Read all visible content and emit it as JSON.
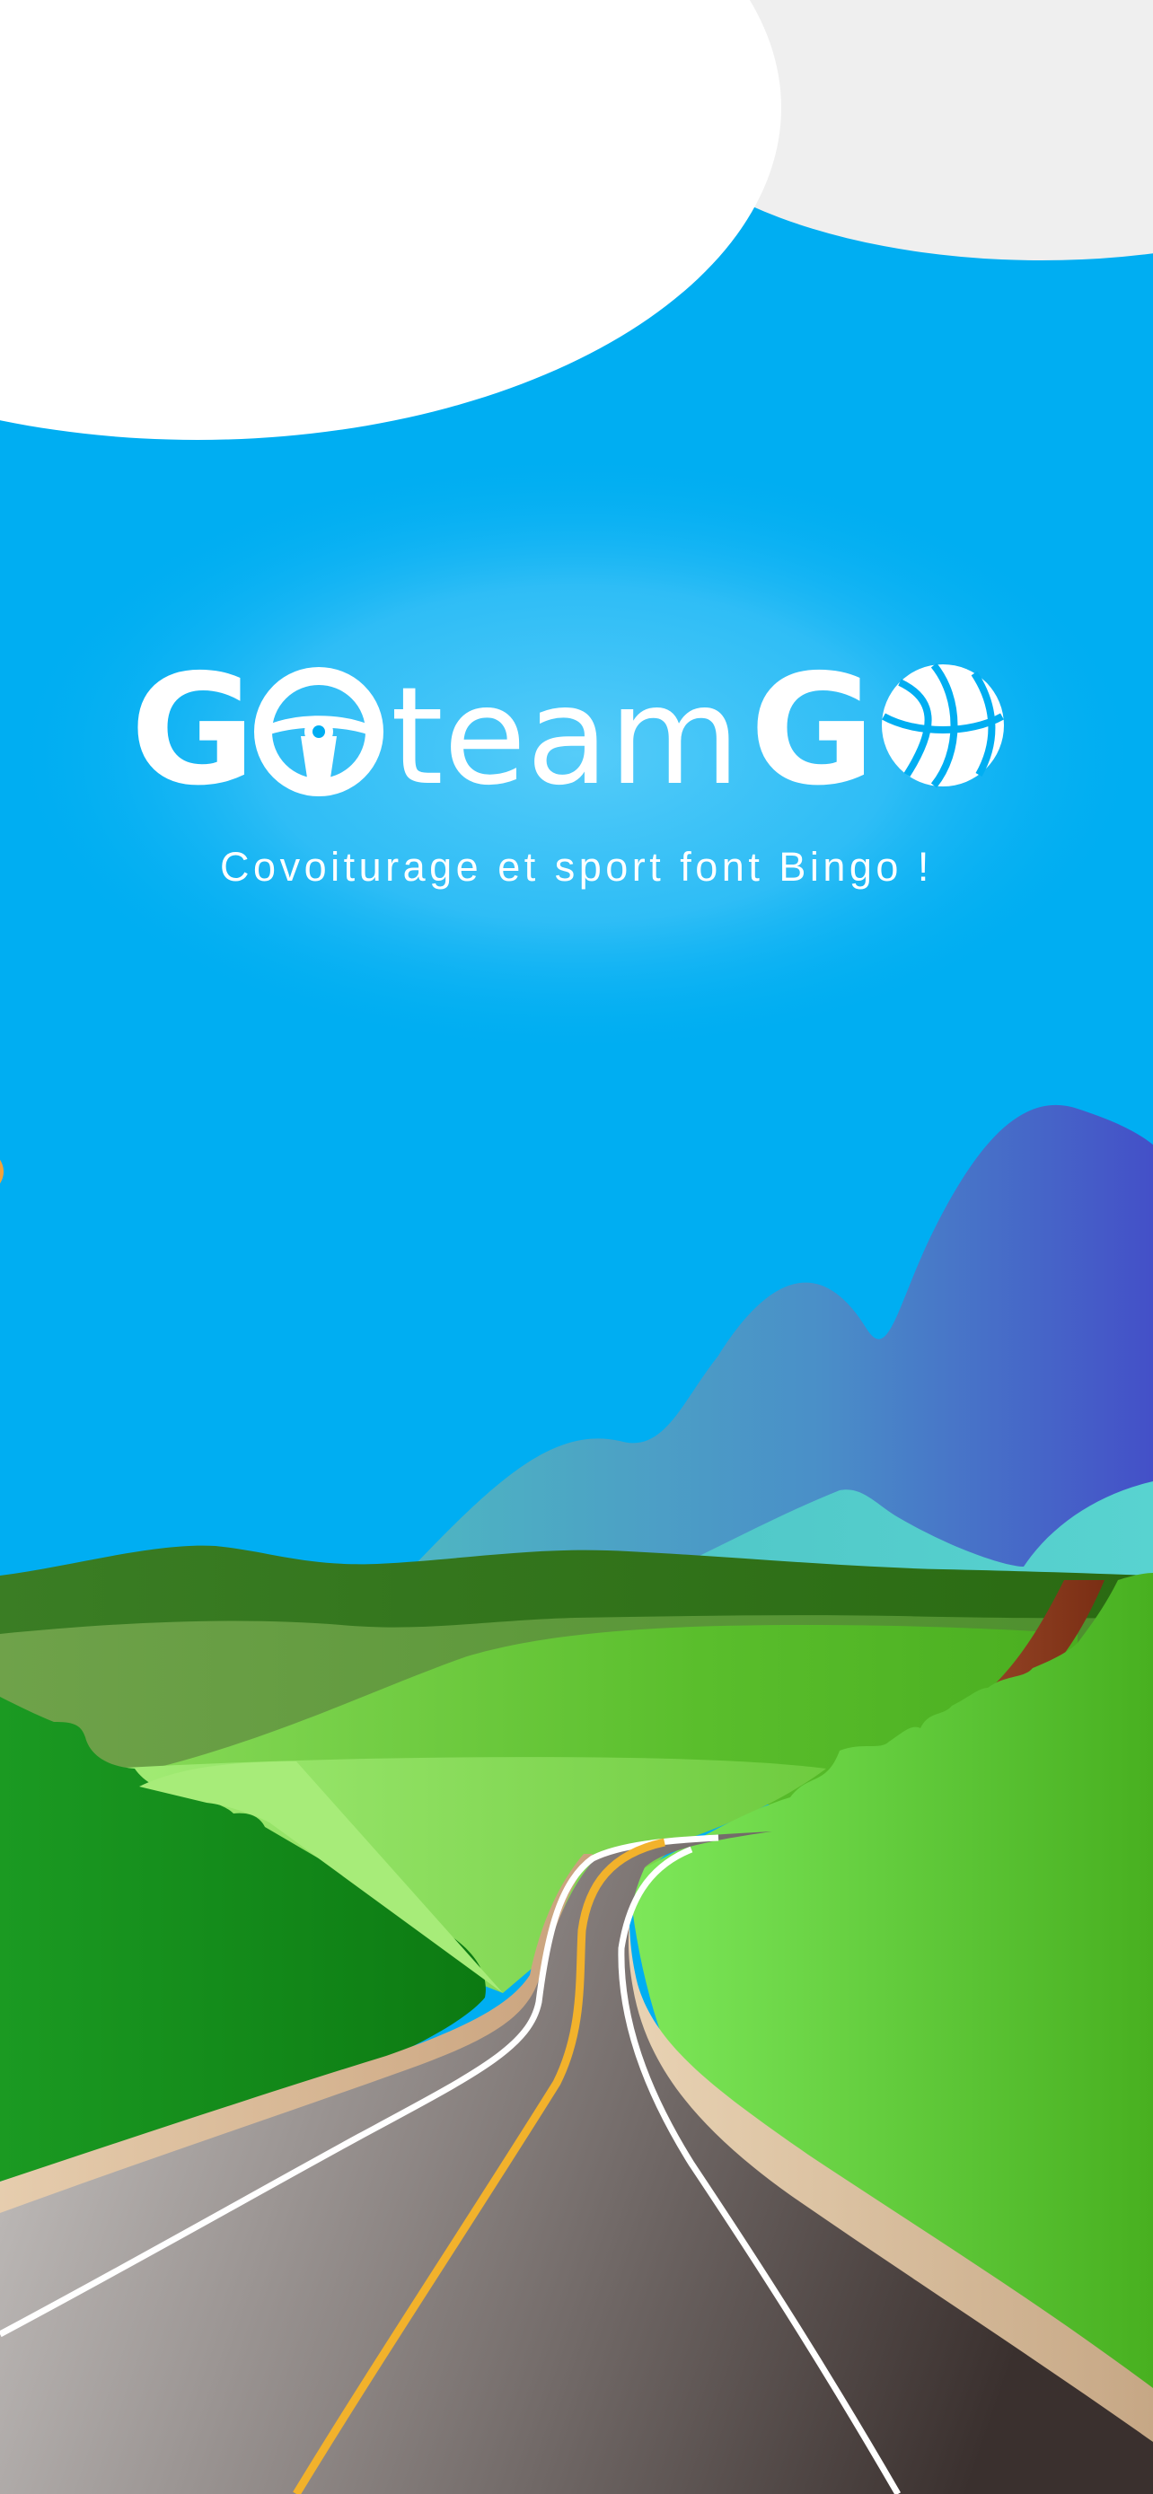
{
  "app": {
    "name_part1": "G",
    "name_part2": "team",
    "name_part3": "G",
    "tagline": "Covoiturage et sport font Bingo !"
  },
  "icons": {
    "logo_o1": "steering-wheel-icon",
    "logo_o2": "basketball-icon"
  },
  "colors": {
    "sky": "#00AEF2",
    "sky_glow": "#4CC8F8",
    "cloud_left": "#FFFFFF",
    "cloud_right": "#EFEFEF",
    "road_center_line": "#F2B22B",
    "road_edge_line": "#FFFFFF",
    "logo": "#FFFFFF"
  }
}
